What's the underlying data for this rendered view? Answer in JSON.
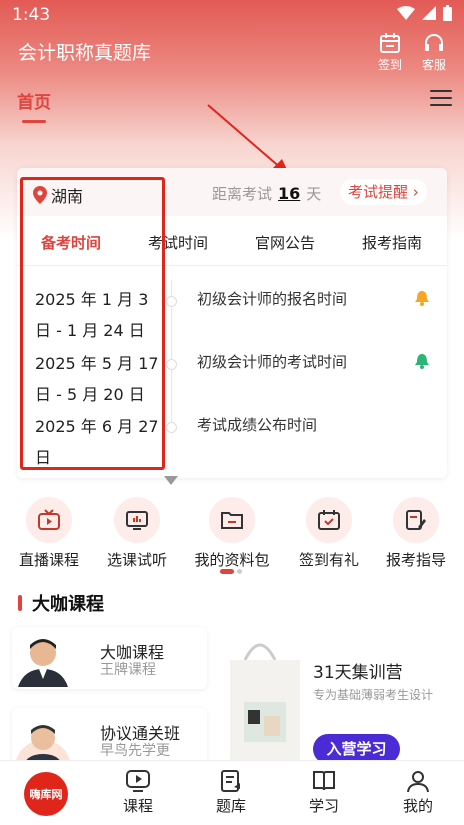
{
  "status": {
    "time": "1:43"
  },
  "header": {
    "title": "会计职称真题库",
    "checkin_label": "签到",
    "service_label": "客服"
  },
  "nav": {
    "home_tab": "首页"
  },
  "exam_card": {
    "location": "湖南",
    "countdown_prefix": "距离考试",
    "countdown_days": "16",
    "countdown_suffix": "天",
    "remind_label": "考试提醒",
    "tabs": [
      "备考时间",
      "考试时间",
      "官网公告",
      "报考指南"
    ],
    "dates": [
      "2025 年 1 月 3 日 - 1 月 24 日",
      "2025 年 5 月 17 日 - 5 月 20 日",
      "2025 年 6 月 27 日"
    ],
    "events": [
      "初级会计师的报名时间",
      "初级会计师的考试时间",
      "考试成绩公布时间"
    ],
    "colors": {
      "bell_orange": "#f5a623",
      "bell_green": "#2bb673"
    }
  },
  "quick_links": [
    {
      "label": "直播课程",
      "icon": "live-tv-icon"
    },
    {
      "label": "选课试听",
      "icon": "video-chart-icon"
    },
    {
      "label": "我的资料包",
      "icon": "folder-icon"
    },
    {
      "label": "签到有礼",
      "icon": "calendar-check-icon"
    },
    {
      "label": "报考指导",
      "icon": "document-edit-icon"
    }
  ],
  "section": {
    "title": "大咖课程"
  },
  "courses": [
    {
      "name": "大咖课程",
      "sub": "王牌课程"
    },
    {
      "name": "协议通关班",
      "sub": "早鸟先学更"
    }
  ],
  "camp": {
    "title": "31天集训营",
    "subtitle": "专为基础薄弱考生设计",
    "button": "入营学习"
  },
  "bottom_nav": {
    "logo_text": "嗨库网",
    "items": [
      "课程",
      "题库",
      "学习",
      "我的"
    ]
  },
  "theme": {
    "accent": "#e0443e",
    "highlight_box": "#e0251b",
    "camp_button": "#4a2bd6"
  }
}
